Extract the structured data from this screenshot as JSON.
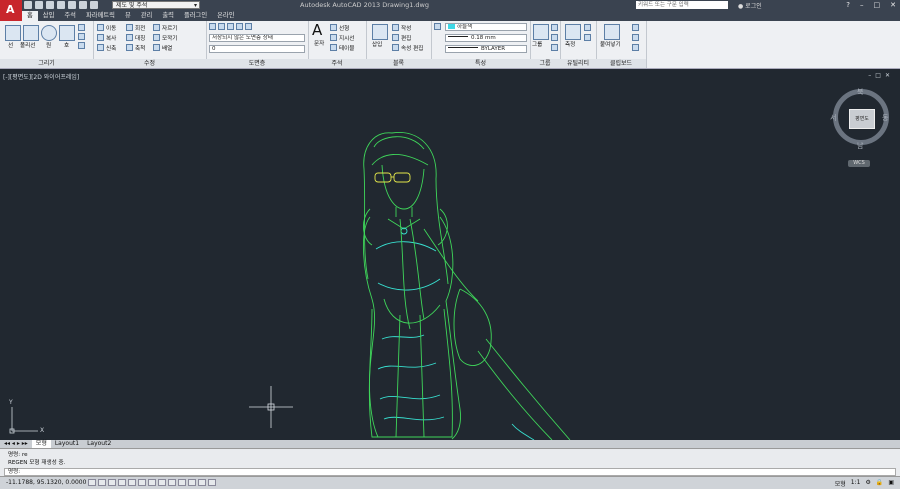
{
  "titlebar": {
    "app_letter": "A",
    "workspace": "제도 및 주석",
    "title": "Autodesk AutoCAD 2013  Drawing1.dwg",
    "search_placeholder": "키워드 또는 구문 입력",
    "login_label": "로그인",
    "help_label": "?"
  },
  "tabs": [
    "홈",
    "삽입",
    "주석",
    "파라메트릭",
    "뷰",
    "관리",
    "출력",
    "플러그인",
    "온라인"
  ],
  "ribbon": {
    "draw": {
      "line": "선",
      "polyline": "폴리선",
      "circle": "원",
      "arc": "호",
      "label": "그리기"
    },
    "modify": {
      "move": "이동",
      "rotate": "회전",
      "trim": "자르기",
      "copy": "복사",
      "mirror": "대칭",
      "fillet": "모깍기",
      "stretch": "신축",
      "scale": "축척",
      "array": "배열",
      "label": "수정"
    },
    "layer": {
      "state": "저장되지 않은 도면층 상태",
      "current": "0",
      "label": "도면층"
    },
    "annotation": {
      "text": "문자",
      "linear": "선형",
      "leader": "지시선",
      "table": "테이블",
      "label": "주석"
    },
    "block": {
      "insert": "삽입",
      "create": "작성",
      "edit": "편집",
      "attrib_edit": "속성 편집",
      "label": "블록"
    },
    "properties": {
      "color": "하늘색",
      "lineweight": "0.18 mm",
      "linetype": "BYLAYER",
      "label": "특성"
    },
    "groups": {
      "group": "그룹",
      "label": "그룹"
    },
    "utilities": {
      "measure": "측정",
      "label": "유틸리티"
    },
    "clipboard": {
      "paste": "붙여넣기",
      "label": "클립보드"
    }
  },
  "viewport": {
    "label": "[-][평면도][2D 와이어프레임]",
    "cube_face": "평면도",
    "north": "북",
    "south": "남",
    "east": "동",
    "west": "서",
    "wcs": "WCS",
    "axis_x": "X",
    "axis_y": "Y"
  },
  "layout_tabs": [
    "모형",
    "Layout1",
    "Layout2"
  ],
  "command": {
    "history": [
      "명령: re",
      "REGEN 모형 재생성 중.",
      "명령:"
    ],
    "line1": "명령: re",
    "line2": "REGEN 모형 재생성 중.",
    "prompt": "명령:"
  },
  "status": {
    "coords": "-11.1788, 95.1320, 0.0000",
    "model": "모형",
    "scale": "1:1"
  },
  "colors": {
    "drawing_green": "#3fd65a",
    "drawing_cyan": "#38e0d0",
    "accent": "#c8262c"
  }
}
